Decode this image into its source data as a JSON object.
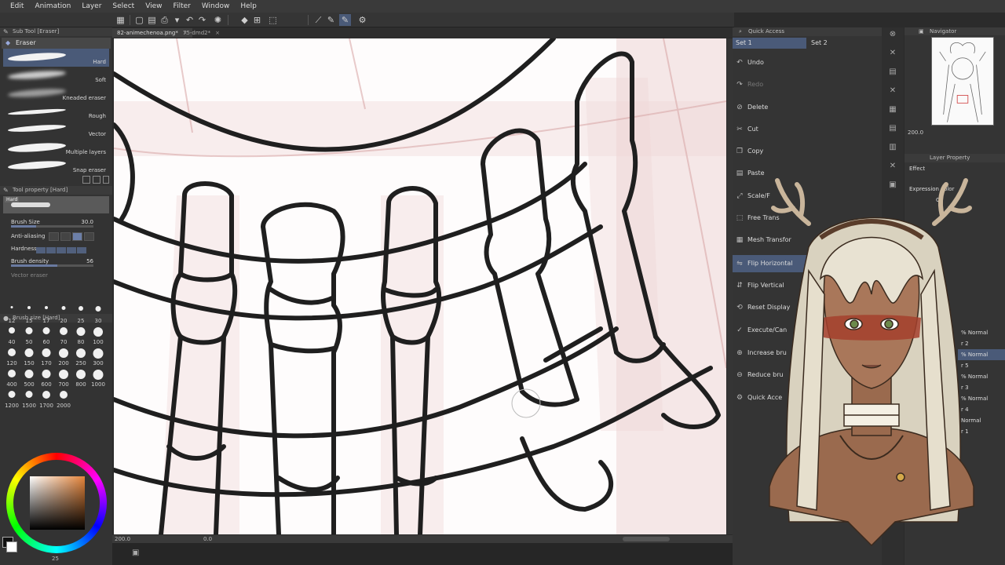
{
  "menu": [
    "Edit",
    "Animation",
    "Layer",
    "Select",
    "View",
    "Filter",
    "Window",
    "Help"
  ],
  "tabs": [
    {
      "label": "82-animechenoa.png*",
      "active": true
    },
    {
      "label": "75-dmd2*",
      "active": false
    }
  ],
  "sub_tool": {
    "panel_title": "Sub Tool [Eraser]",
    "tab": "Eraser",
    "brushes": [
      "Hard",
      "Soft",
      "Kneaded eraser",
      "Rough",
      "Vector",
      "Multiple layers",
      "Snap eraser"
    ]
  },
  "tool_property": {
    "panel_title": "Tool property [Hard]",
    "preview_label": "Hard",
    "brush_size_label": "Brush Size",
    "brush_size_value": "30.0",
    "anti_aliasing_label": "Anti-aliasing",
    "hardness_label": "Hardness",
    "brush_density_label": "Brush density",
    "brush_density_value": "56",
    "vector_eraser_label": "Vector eraser"
  },
  "brush_size_panel": {
    "title": "Brush size [Hard]",
    "sizes": [
      "12",
      "15",
      "17",
      "20",
      "25",
      "30",
      "40",
      "50",
      "60",
      "70",
      "80",
      "100",
      "120",
      "150",
      "170",
      "200",
      "250",
      "300",
      "400",
      "500",
      "600",
      "700",
      "800",
      "1000",
      "1200",
      "1500",
      "1700",
      "2000"
    ]
  },
  "status": {
    "zoom": "200.0",
    "angle": "0.0",
    "bottom_left": "25"
  },
  "quick_access": {
    "title": "Quick Access",
    "sets": [
      "Set 1",
      "Set 2"
    ],
    "items": [
      {
        "label": "Undo",
        "icon": "undo-icon",
        "disabled": false
      },
      {
        "label": "Redo",
        "icon": "redo-icon",
        "disabled": true
      },
      {
        "label": "Delete",
        "icon": "delete-icon",
        "disabled": false
      },
      {
        "label": "Cut",
        "icon": "cut-icon",
        "disabled": false
      },
      {
        "label": "Copy",
        "icon": "copy-icon",
        "disabled": false
      },
      {
        "label": "Paste",
        "icon": "paste-icon",
        "disabled": false
      },
      {
        "label": "Scale/F",
        "icon": "scale-icon",
        "disabled": false
      },
      {
        "label": "Free Trans",
        "icon": "free-transform-icon",
        "disabled": false
      },
      {
        "label": "Mesh Transfor",
        "icon": "mesh-transform-icon",
        "disabled": false
      },
      {
        "label": "Flip Horizontal",
        "icon": "flip-horizontal-icon",
        "disabled": false,
        "highlighted": true
      },
      {
        "label": "Flip Vertical",
        "icon": "flip-vertical-icon",
        "disabled": false
      },
      {
        "label": "Reset Display",
        "icon": "reset-display-icon",
        "disabled": false
      },
      {
        "label": "Execute/Can",
        "icon": "execute-icon",
        "disabled": false
      },
      {
        "label": "Increase bru",
        "icon": "increase-brush-icon",
        "disabled": false
      },
      {
        "label": "Reduce bru",
        "icon": "reduce-brush-icon",
        "disabled": false
      },
      {
        "label": "Quick Acce",
        "icon": "quick-access-icon",
        "disabled": false
      }
    ]
  },
  "navigator": {
    "title": "Navigator",
    "zoom": "200.0"
  },
  "layer_property": {
    "title": "Layer Property",
    "effect_label": "Effect",
    "expression_color_label": "Expression color",
    "color_value": "Co"
  },
  "layers": [
    {
      "label": "% Normal",
      "selected": false
    },
    {
      "label": "r 2",
      "selected": false
    },
    {
      "label": "% Normal",
      "selected": true
    },
    {
      "label": "r 5",
      "selected": false
    },
    {
      "label": "% Normal",
      "selected": false
    },
    {
      "label": "r 3",
      "selected": false
    },
    {
      "label": "% Normal",
      "selected": false
    },
    {
      "label": "r 4",
      "selected": false
    },
    {
      "label": "Normal",
      "selected": false
    },
    {
      "label": "r 1",
      "selected": false
    }
  ],
  "colors": {
    "accent": "#4a5a78",
    "canvas": "#fefcfc",
    "sketch": "#d9a8a8",
    "line": "#1f1f1f"
  }
}
